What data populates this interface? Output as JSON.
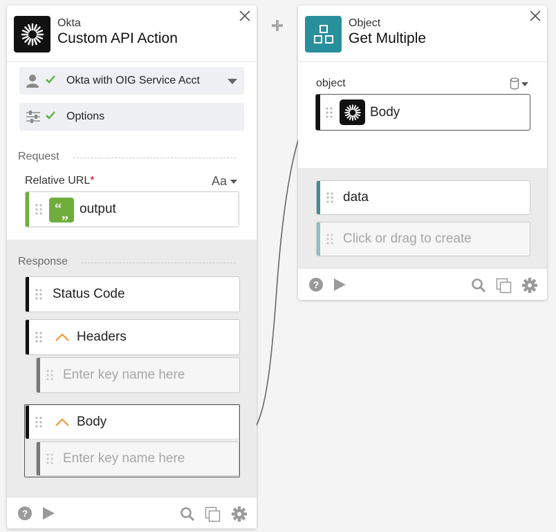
{
  "left_card": {
    "app": "Okta",
    "title": "Custom API Action",
    "icon": "okta-sunburst-icon",
    "connection": {
      "label": "Okta with OIG Service Acct"
    },
    "options": {
      "label": "Options"
    },
    "request": {
      "section_label": "Request",
      "field_label": "Relative URL",
      "required_mark": "*",
      "type_selector": "Aa",
      "value": "output"
    },
    "response": {
      "section_label": "Response",
      "status_code": "Status Code",
      "headers": "Headers",
      "headers_placeholder": "Enter key name here",
      "body": "Body",
      "body_placeholder": "Enter key name here"
    }
  },
  "right_card": {
    "app": "Object",
    "title": "Get Multiple",
    "icon": "object-squares-icon",
    "input": {
      "label": "object",
      "value": "Body"
    },
    "output": {
      "item": "data",
      "placeholder": "Click or drag to create"
    }
  },
  "colors": {
    "okta_black": "#111111",
    "object_teal": "#2a8f9c",
    "text_green": "#6fae3c",
    "check_green": "#5bb03e",
    "header_orange": "#f0a24b",
    "data_bar_teal": "#3a8f97",
    "placeholder_bar": "#8cc0c6"
  }
}
